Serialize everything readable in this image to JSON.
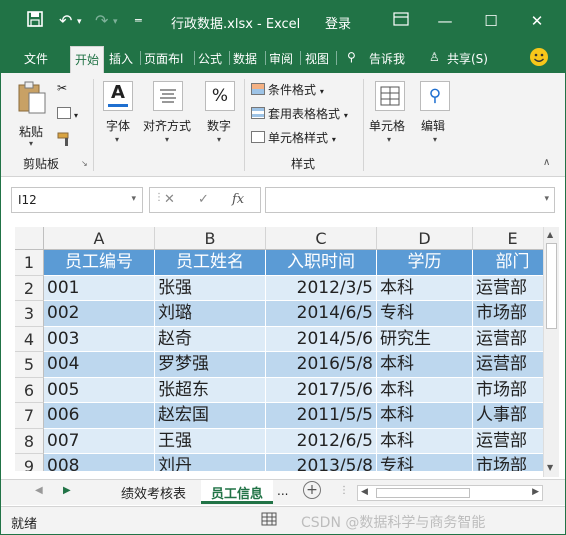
{
  "titlebar": {
    "title": "行政数据.xlsx  -  Excel",
    "login": "登录",
    "save_icon": "save-icon",
    "undo_icon": "undo-icon",
    "redo_icon": "redo-icon"
  },
  "tabs": [
    {
      "label": "文件"
    },
    {
      "label": "开始"
    },
    {
      "label": "插入"
    },
    {
      "label": "页面布l"
    },
    {
      "label": "公式"
    },
    {
      "label": "数据"
    },
    {
      "label": "审阅"
    },
    {
      "label": "视图"
    },
    {
      "label": "告诉我"
    },
    {
      "label": "共享(S)"
    }
  ],
  "ribbon": {
    "paste": "粘贴",
    "clipboard": "剪贴板",
    "font": "字体",
    "alignment": "对齐方式",
    "number": "数字",
    "number_symbol": "%",
    "conditional_format": "条件格式",
    "table_format": "套用表格格式",
    "cell_style": "单元格样式",
    "styles": "样式",
    "cells": "单元格",
    "editing": "编辑",
    "font_letter": "A"
  },
  "formula_bar": {
    "name_box": "I12",
    "fx": "fx",
    "cancel": "✕",
    "confirm": "✓",
    "value": ""
  },
  "grid": {
    "columns": [
      "A",
      "B",
      "C",
      "D",
      "E"
    ],
    "rows": [
      "1",
      "2",
      "3",
      "4",
      "5",
      "6",
      "7",
      "8",
      "9"
    ],
    "header": [
      "员工编号",
      "员工姓名",
      "入职时间",
      "学历",
      "部门"
    ],
    "data": [
      [
        "001",
        "张强",
        "2012/3/5",
        "本科",
        "运营部"
      ],
      [
        "002",
        "刘璐",
        "2014/6/5",
        "专科",
        "市场部"
      ],
      [
        "003",
        "赵奇",
        "2014/5/6",
        "研究生",
        "运营部"
      ],
      [
        "004",
        "罗梦强",
        "2016/5/8",
        "本科",
        "运营部"
      ],
      [
        "005",
        "张超东",
        "2017/5/6",
        "本科",
        "市场部"
      ],
      [
        "006",
        "赵宏国",
        "2011/5/5",
        "本科",
        "人事部"
      ],
      [
        "007",
        "王强",
        "2012/6/5",
        "本科",
        "运营部"
      ],
      [
        "008",
        "刘丹",
        "2013/5/8",
        "专科",
        "市场部"
      ]
    ]
  },
  "sheets": {
    "tabs": [
      "绩效考核表",
      "员工信息"
    ],
    "more": "...",
    "add": "+"
  },
  "status": {
    "ready": "就绪",
    "watermark": "CSDN @数据科学与商务智能"
  },
  "colors": {
    "excel_green": "#217346",
    "header_blue": "#5b9bd5",
    "row_band_a": "#ddebf7",
    "row_band_b": "#bdd7ee"
  }
}
